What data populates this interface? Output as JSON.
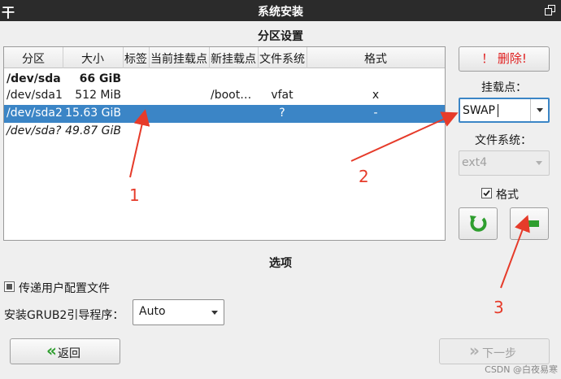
{
  "window": {
    "title": "系统安装",
    "menu_glyph": "干"
  },
  "partition_section": {
    "title": "分区设置"
  },
  "table": {
    "columns": [
      "分区",
      "大小",
      "标签",
      "当前挂载点",
      "新挂载点",
      "文件系统",
      "格式"
    ],
    "rows": [
      {
        "partition": "/dev/sda",
        "size": "66 GiB",
        "label": "",
        "current_mount": "",
        "new_mount": "",
        "filesystem": "",
        "format": ""
      },
      {
        "partition": "/dev/sda1",
        "size": "512 MiB",
        "label": "",
        "current_mount": "",
        "new_mount": "/boot…",
        "filesystem": "vfat",
        "format": "x"
      },
      {
        "partition": "/dev/sda2",
        "size": "15.63 GiB",
        "label": "",
        "current_mount": "",
        "new_mount": "",
        "filesystem": "?",
        "format": "-"
      },
      {
        "partition": "/dev/sda?",
        "size": "49.87 GiB",
        "label": "",
        "current_mount": "",
        "new_mount": "",
        "filesystem": "",
        "format": ""
      }
    ],
    "selected_row": 2
  },
  "side_panel": {
    "delete_label": "！ 删除!",
    "mount_label": "挂载点：",
    "mount_value": "SWAP",
    "fs_label": "文件系统：",
    "fs_value": "ext4",
    "format_label": "格式",
    "format_checked": true
  },
  "options_section": {
    "title": "选项",
    "pass_config_label": "传递用户配置文件",
    "pass_config_checked": false,
    "grub_label": "安装GRUB2引导程序：",
    "grub_value": "Auto"
  },
  "footer": {
    "back_label": "返回",
    "back_glyph": "«",
    "next_label": "下一步",
    "next_glyph": "»"
  },
  "annotations": [
    "1",
    "2",
    "3"
  ],
  "watermark": "CSDN @白夜易寒",
  "colors": {
    "selection": "#3b85c6",
    "arrow_red": "#e63b2a",
    "delete_red": "#e02020",
    "green": "#2e9e2e"
  }
}
